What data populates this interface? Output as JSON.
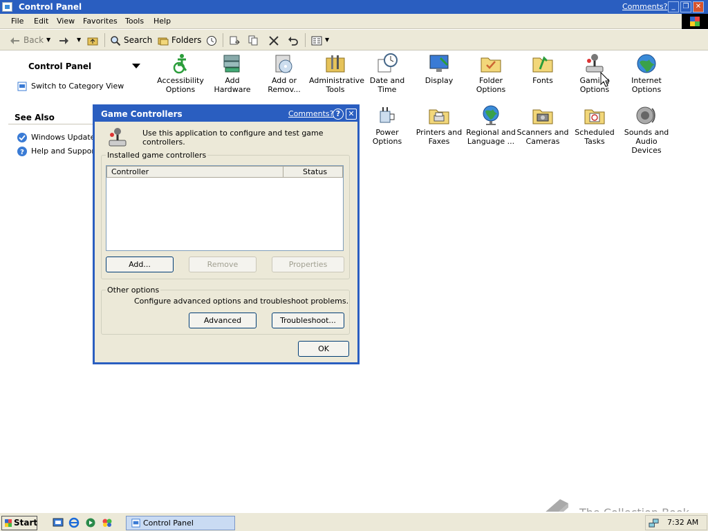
{
  "window": {
    "title": "Control Panel",
    "comments": "Comments?",
    "controls": {
      "minimize": "_",
      "restore": "❐",
      "close": "✕"
    }
  },
  "menu": [
    "File",
    "Edit",
    "View",
    "Favorites",
    "Tools",
    "Help"
  ],
  "toolbar": {
    "back": "Back",
    "search": "Search",
    "folders": "Folders"
  },
  "left_panel": {
    "title": "Control Panel",
    "switch_view": "Switch to Category View",
    "see_also": "See Also",
    "links": [
      "Windows Update",
      "Help and Support"
    ]
  },
  "icons_row1": [
    [
      "Accessibility",
      "Options"
    ],
    [
      "Add Hardware",
      ""
    ],
    [
      "Add or",
      "Remov..."
    ],
    [
      "Administrative",
      "Tools"
    ],
    [
      "Date and Time",
      ""
    ],
    [
      "Display",
      ""
    ],
    [
      "Folder Options",
      ""
    ],
    [
      "Fonts",
      ""
    ],
    [
      "Gaming",
      "Options"
    ],
    [
      "Internet",
      "Options"
    ]
  ],
  "icons_row2": [
    [
      "Power Options",
      ""
    ],
    [
      "Printers and",
      "Faxes"
    ],
    [
      "Regional and",
      "Language ..."
    ],
    [
      "Scanners and",
      "Cameras"
    ],
    [
      "Scheduled",
      "Tasks"
    ],
    [
      "Sounds and",
      "Audio Devices"
    ]
  ],
  "dialog": {
    "title": "Game Controllers",
    "comments": "Comments?",
    "help": "?",
    "close": "✕",
    "intro": "Use this application to configure and test game controllers.",
    "installed_legend": "Installed game controllers",
    "columns": [
      "Controller",
      "Status"
    ],
    "buttons": {
      "add": "Add...",
      "remove": "Remove",
      "properties": "Properties"
    },
    "other_legend": "Other options",
    "other_text": "Configure advanced options and troubleshoot problems.",
    "advanced": "Advanced",
    "troubleshoot": "Troubleshoot...",
    "ok": "OK"
  },
  "taskbar": {
    "start": "Start",
    "task": "Control Panel",
    "clock": "7:32 AM"
  },
  "watermark": "The Collection Book",
  "colors": {
    "title_blue": "#2a5ec0",
    "face": "#ece9d8",
    "link_blue": "#0000ff"
  }
}
